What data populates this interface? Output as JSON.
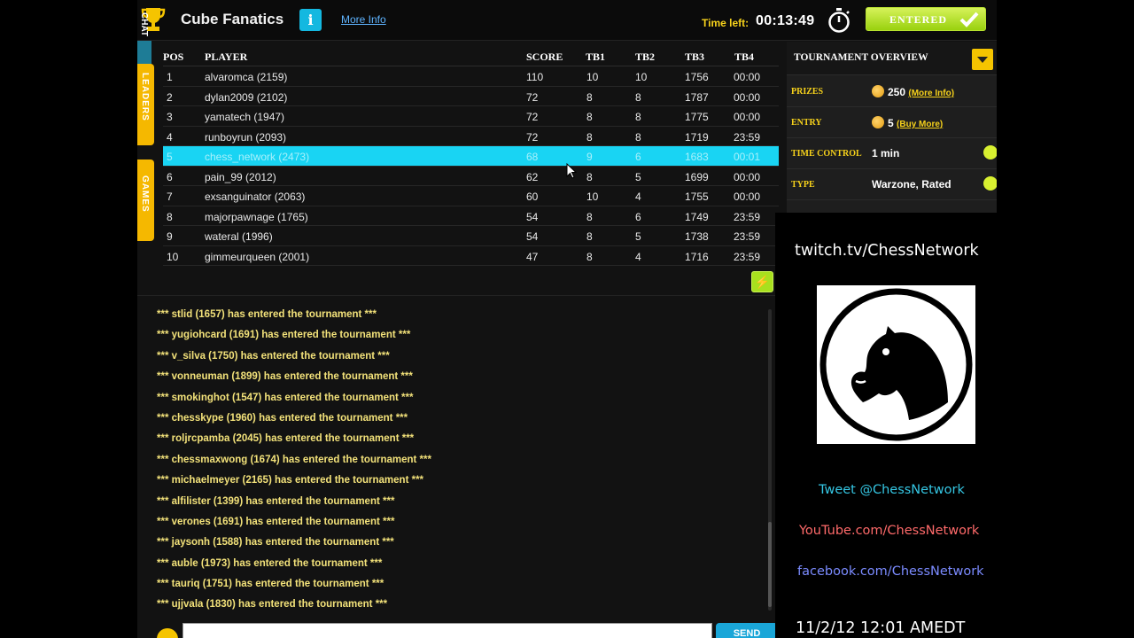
{
  "header": {
    "title": "Cube Fanatics",
    "info_icon_label": "i",
    "more_info_label": "More Info",
    "time_left_label": "Time left:",
    "time_left_value": "00:13:49",
    "entered_label": "ENTERED"
  },
  "side_tabs": {
    "leaders": "LEADERS",
    "games": "GAMES",
    "chat": "CHAT"
  },
  "leaderboard": {
    "columns": [
      "POS",
      "PLAYER",
      "SCORE",
      "TB1",
      "TB2",
      "TB3",
      "TB4"
    ],
    "highlighted_row": 4,
    "rows": [
      {
        "pos": "1",
        "player": "alvaromca (2159)",
        "score": "110",
        "tb1": "10",
        "tb2": "10",
        "tb3": "1756",
        "tb4": "00:00"
      },
      {
        "pos": "2",
        "player": "dylan2009 (2102)",
        "score": "72",
        "tb1": "8",
        "tb2": "8",
        "tb3": "1787",
        "tb4": "00:00"
      },
      {
        "pos": "3",
        "player": "yamatech (1947)",
        "score": "72",
        "tb1": "8",
        "tb2": "8",
        "tb3": "1775",
        "tb4": "00:00"
      },
      {
        "pos": "4",
        "player": "runboyrun (2093)",
        "score": "72",
        "tb1": "8",
        "tb2": "8",
        "tb3": "1719",
        "tb4": "23:59"
      },
      {
        "pos": "5",
        "player": "chess_network (2473)",
        "score": "68",
        "tb1": "9",
        "tb2": "6",
        "tb3": "1683",
        "tb4": "00:01"
      },
      {
        "pos": "6",
        "player": "pain_99 (2012)",
        "score": "62",
        "tb1": "8",
        "tb2": "5",
        "tb3": "1699",
        "tb4": "00:00"
      },
      {
        "pos": "7",
        "player": "exsanguinator (2063)",
        "score": "60",
        "tb1": "10",
        "tb2": "4",
        "tb3": "1755",
        "tb4": "00:00"
      },
      {
        "pos": "8",
        "player": "majorpawnage (1765)",
        "score": "54",
        "tb1": "8",
        "tb2": "6",
        "tb3": "1749",
        "tb4": "23:59"
      },
      {
        "pos": "9",
        "player": "wateral (1996)",
        "score": "54",
        "tb1": "8",
        "tb2": "5",
        "tb3": "1738",
        "tb4": "23:59"
      },
      {
        "pos": "10",
        "player": "gimmeurqueen (2001)",
        "score": "47",
        "tb1": "8",
        "tb2": "4",
        "tb3": "1716",
        "tb4": "23:59"
      }
    ]
  },
  "chat": {
    "messages": [
      "*** stlid (1657) has entered the tournament ***",
      "*** yugiohcard (1691) has entered the tournament ***",
      "*** v_silva (1750) has entered the tournament ***",
      "*** vonneuman (1899) has entered the tournament ***",
      "*** smokinghot (1547) has entered the tournament ***",
      "*** chesskype (1960) has entered the tournament ***",
      "*** roljrcpamba (2045) has entered the tournament ***",
      "*** chessmaxwong (1674) has entered the tournament ***",
      "*** michaelmeyer (2165) has entered the tournament ***",
      "*** alfilister (1399) has entered the tournament ***",
      "*** verones (1691) has entered the tournament ***",
      "*** jaysonh (1588) has entered the tournament ***",
      "*** auble (1973) has entered the tournament ***",
      "*** tauriq (1751) has entered the tournament ***",
      "*** ujjvala (1830) has entered the tournament ***"
    ],
    "input_value": "",
    "send_label": "SEND"
  },
  "overview": {
    "title": "TOURNAMENT OVERVIEW",
    "prizes_label": "PRIZES",
    "prizes_value": "250",
    "prizes_link": "(More Info)",
    "entry_label": "ENTRY",
    "entry_value": "5",
    "entry_link": "(Buy More)",
    "time_control_label": "TIME CONTROL",
    "time_control_value": "1 min",
    "type_label": "TYPE",
    "type_value": "Warzone, Rated"
  },
  "stream_overlay": {
    "twitch": "twitch.tv/ChessNetwork",
    "tweet": "Tweet @ChessNetwork",
    "youtube": "YouTube.com/ChessNetwork",
    "facebook": "facebook.com/ChessNetwork",
    "clock": "11/2/12 12:01 AMEDT"
  },
  "colors": {
    "accent_yellow": "#f5c400",
    "highlight_row": "#19d4f3",
    "entered_green": "#a8e01e",
    "chat_text": "#f3e27a"
  }
}
